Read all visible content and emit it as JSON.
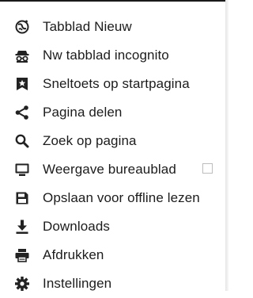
{
  "menu": {
    "items": [
      {
        "label": "Tabblad Nieuw",
        "icon": "new-tab-icon"
      },
      {
        "label": "Nw tabblad incognito",
        "icon": "incognito-icon"
      },
      {
        "label": "Sneltoets op startpagina",
        "icon": "bookmark-star-icon"
      },
      {
        "label": "Pagina delen",
        "icon": "share-icon"
      },
      {
        "label": "Zoek op pagina",
        "icon": "search-icon"
      },
      {
        "label": "Weergave bureaublad",
        "icon": "desktop-monitor-icon",
        "checkbox": false
      },
      {
        "label": "Opslaan voor offline lezen",
        "icon": "save-floppy-icon"
      },
      {
        "label": "Downloads",
        "icon": "download-icon"
      },
      {
        "label": "Afdrukken",
        "icon": "printer-icon"
      },
      {
        "label": "Instellingen",
        "icon": "settings-gear-icon"
      }
    ]
  },
  "colors": {
    "text": "#1c1c1c",
    "icon": "#222222",
    "background": "#ffffff",
    "checkbox_border": "#bdbdbd"
  }
}
